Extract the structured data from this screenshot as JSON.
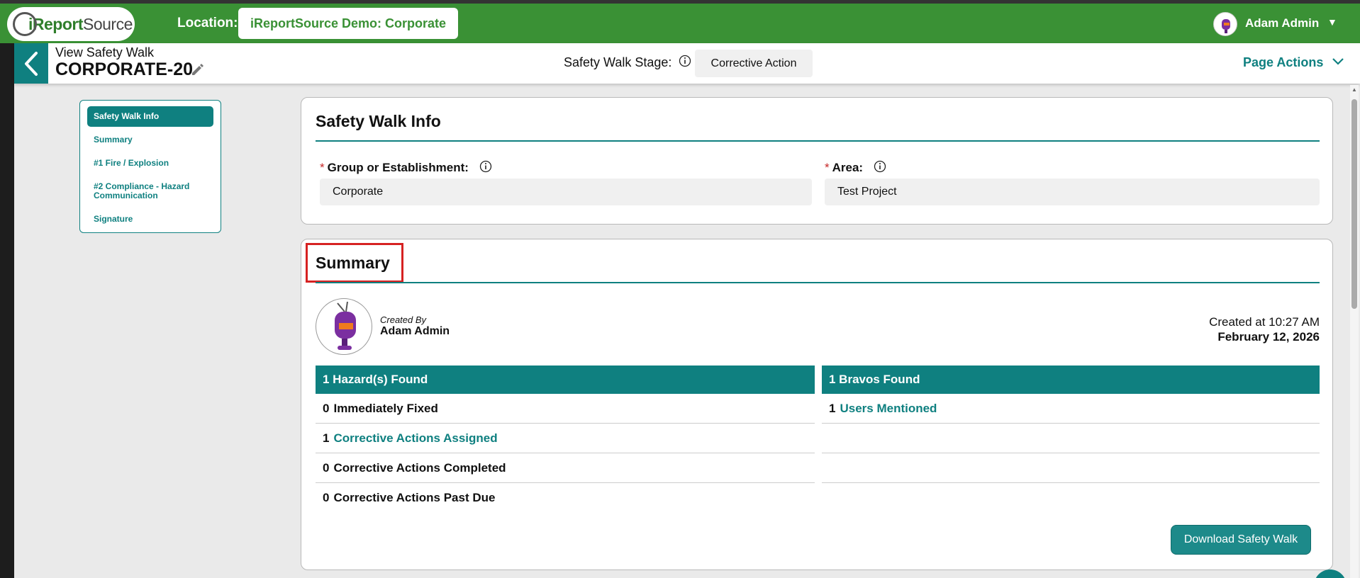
{
  "topbar": {
    "logo_text_a": "iReport",
    "logo_text_b": "Source",
    "location_label": "Location:",
    "location_value": "iReportSource Demo: Corporate",
    "user_name": "Adam Admin"
  },
  "header": {
    "view_label": "View Safety Walk",
    "record_id": "CORPORATE-20",
    "stage_label": "Safety Walk Stage:",
    "stage_value": "Corrective Action",
    "page_actions": "Page Actions"
  },
  "sidenav": {
    "items": [
      {
        "label": "Safety Walk Info",
        "active": true
      },
      {
        "label": "Summary",
        "active": false
      },
      {
        "label": "#1 Fire / Explosion",
        "active": false
      },
      {
        "label": "#2 Compliance - Hazard Communication",
        "active": false
      },
      {
        "label": "Signature",
        "active": false
      }
    ]
  },
  "info_card": {
    "title": "Safety Walk Info",
    "group_label": "Group or Establishment:",
    "group_value": "Corporate",
    "area_label": "Area:",
    "area_value": "Test Project",
    "required_mark": "*"
  },
  "summary": {
    "title": "Summary",
    "created_by_label": "Created By",
    "creator_name": "Adam Admin",
    "created_at": "Created at 10:27 AM",
    "created_date": "February 12, 2026",
    "hazards_header": "1 Hazard(s) Found",
    "hazard_rows": [
      {
        "count": "0",
        "label": "Immediately Fixed",
        "link": false
      },
      {
        "count": "1",
        "label": "Corrective Actions Assigned",
        "link": true
      },
      {
        "count": "0",
        "label": "Corrective Actions Completed",
        "link": false
      },
      {
        "count": "0",
        "label": "Corrective Actions Past Due",
        "link": false
      }
    ],
    "bravos_header": "1 Bravos Found",
    "bravo_rows": [
      {
        "count": "1",
        "label": "Users Mentioned",
        "link": true
      }
    ],
    "download_label": "Download Safety Walk"
  },
  "colors": {
    "brand_green": "#3a9135",
    "teal": "#0f8080",
    "highlight_red": "#d62222"
  }
}
